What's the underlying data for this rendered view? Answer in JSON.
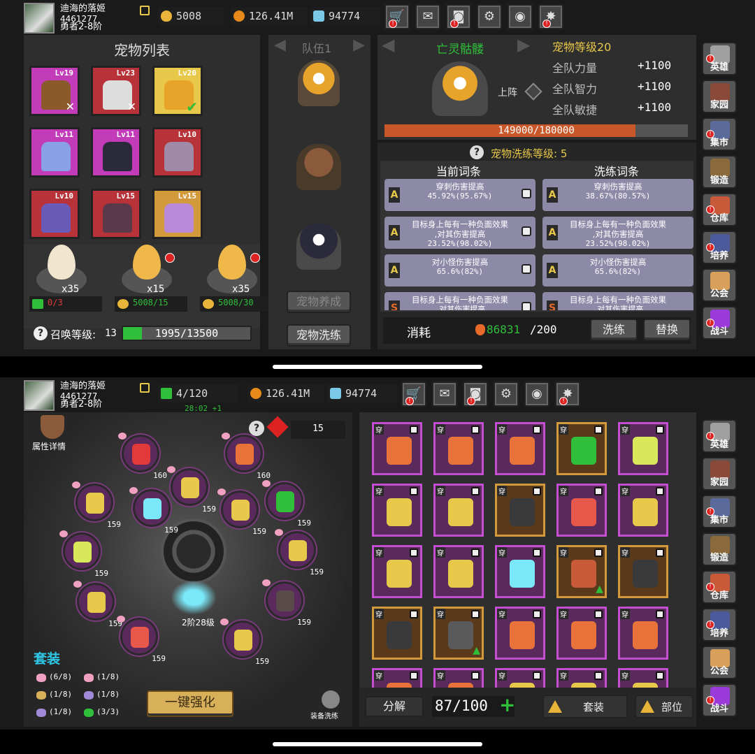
{
  "top": {
    "header": {
      "player_name": "迪海的落姬",
      "player_id": "4461277",
      "player_rank": "勇者2-8阶",
      "gold": "5008",
      "coins": "126.41M",
      "gems": "94774"
    },
    "pet_list": {
      "title": "宠物列表",
      "pets": [
        {
          "level": "Lv19",
          "color": "#c23bb8"
        },
        {
          "level": "Lv23",
          "color": "#b8323a"
        },
        {
          "level": "Lv20",
          "color": "#e8c84a"
        },
        {
          "level": "Lv11",
          "color": "#c23bb8"
        },
        {
          "level": "Lv11",
          "color": "#c23bb8"
        },
        {
          "level": "Lv10",
          "color": "#b8323a"
        },
        {
          "level": "Lv10",
          "color": "#b8323a"
        },
        {
          "level": "Lv15",
          "color": "#b8323a"
        },
        {
          "level": "Lv15",
          "color": "#d29a3a"
        }
      ],
      "eggs": [
        {
          "count": "x35"
        },
        {
          "count": "x15"
        },
        {
          "count": "x35"
        }
      ],
      "egg_costs": [
        {
          "value": "0/3"
        },
        {
          "value": "5008/15"
        },
        {
          "value": "5008/30"
        }
      ],
      "summon_label": "召唤等级:",
      "summon_level": "13",
      "summon_progress": "1995/13500",
      "summon_fraction": 0.148
    },
    "team": {
      "label": "队伍1",
      "feed_btn": "宠物养成",
      "wash_btn": "宠物洗练"
    },
    "pet_detail": {
      "name": "亡灵骷髅",
      "level_label": "宠物等级20",
      "deploy": "上阵",
      "stats": [
        {
          "label": "全队力量",
          "value": "+1100"
        },
        {
          "label": "全队智力",
          "value": "+1100"
        },
        {
          "label": "全队敏捷",
          "value": "+1100"
        }
      ],
      "exp": "149000/180000",
      "exp_fraction": 0.828
    },
    "wash": {
      "level_label": "宠物洗练等级: 5",
      "current_header": "当前词条",
      "wash_header": "洗练词条",
      "current": [
        {
          "line1": "穿刺伤害提高",
          "line2": "45.92%(95.67%)"
        },
        {
          "line1": "目标身上每有一种负面效果",
          "line2": ",对其伤害提高",
          "line3": "23.52%(98.02%)"
        },
        {
          "line1": "对小怪伤害提高",
          "line2": "65.6%(82%)"
        },
        {
          "line1": "目标身上每有一种负面效果",
          "line2": ",对其伤害提高"
        }
      ],
      "washed": [
        {
          "line1": "穿刺伤害提高",
          "line2": "38.67%(80.57%)"
        },
        {
          "line1": "目标身上每有一种负面效果",
          "line2": ",对其伤害提高",
          "line3": "23.52%(98.02%)"
        },
        {
          "line1": "对小怪伤害提高",
          "line2": "65.6%(82%)"
        },
        {
          "line1": "目标身上每有一种负面效果",
          "line2": ",对其伤害提高"
        }
      ],
      "cost_label": "消耗",
      "cost_value": "86831",
      "cost_need": "/200",
      "wash_btn": "洗练",
      "replace_btn": "替换"
    }
  },
  "bottom": {
    "header": {
      "player_name": "迪海的落姬",
      "player_id": "4461277",
      "player_rank": "勇者2-8阶",
      "energy": "4/120",
      "timer": "28:02 +1",
      "coins": "126.41M",
      "gems": "94774"
    },
    "attr_detail": "属性详情",
    "ruby_count": "15",
    "ring_levels": [
      "160",
      "160",
      "159",
      "159",
      "159",
      "159",
      "159",
      "159",
      "159",
      "159",
      "159",
      "159",
      "159",
      "159",
      "159"
    ],
    "center_label": "2阶28级",
    "set_title": "套装",
    "sets": [
      "(6/8)",
      "(1/8)",
      "(1/8)",
      "(1/8)",
      "(1/8)",
      "(3/3)"
    ],
    "enhance_btn": "一键强化",
    "wash_label": "装备洗练",
    "decompose_btn": "分解",
    "capacity": "87/100",
    "set_btn": "套装",
    "part_btn": "部位",
    "equip_tag": "穿"
  },
  "sidebar": [
    "英雄",
    "家园",
    "集市",
    "锻造",
    "仓库",
    "培养",
    "公会",
    "战斗"
  ],
  "colors": {
    "exp_bar": "#c8582a",
    "summon_bar": "#2fbf3a",
    "accent_gold": "#e8c84a",
    "purple_frame": "#c44ed1"
  }
}
